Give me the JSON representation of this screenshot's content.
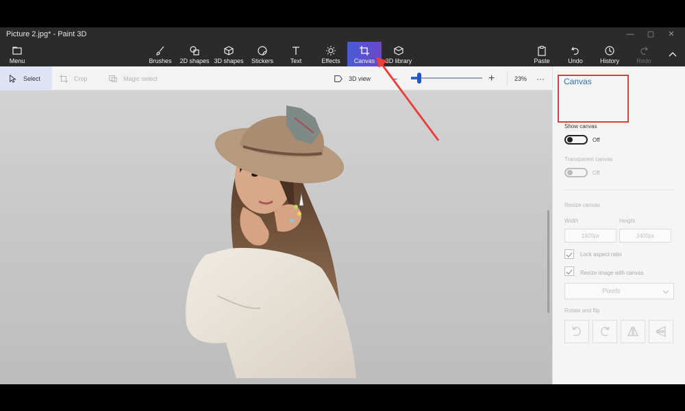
{
  "window": {
    "title": "Picture 2.jpg* - Paint 3D"
  },
  "ribbon": {
    "menu": "Menu",
    "brushes": "Brushes",
    "shapes2d": "2D shapes",
    "shapes3d": "3D shapes",
    "stickers": "Stickers",
    "text": "Text",
    "effects": "Effects",
    "canvas": "Canvas",
    "library3d": "3D library",
    "paste": "Paste",
    "undo": "Undo",
    "history": "History",
    "redo": "Redo"
  },
  "toolbar": {
    "select": "Select",
    "crop": "Crop",
    "magic_select": "Magic select",
    "view3d": "3D view",
    "zoom": "23%",
    "zoom_level": 0.23
  },
  "panel": {
    "title": "Canvas",
    "show_canvas": "Show canvas",
    "show_canvas_state": "Off",
    "transparent_canvas": "Transparent canvas",
    "transparent_state": "Off",
    "resize_canvas": "Resize canvas",
    "width_label": "Width",
    "height_label": "Height",
    "width_value": "1920px",
    "height_value": "2400px",
    "lock_aspect": "Lock aspect ratio",
    "resize_image": "Resize image with canvas",
    "units": "Pixels",
    "rotate_flip": "Rotate and flip"
  },
  "colors": {
    "accent": "#2b6fb5",
    "highlight": "#e03a3a",
    "ribbon_bg": "#2b2b2b"
  }
}
